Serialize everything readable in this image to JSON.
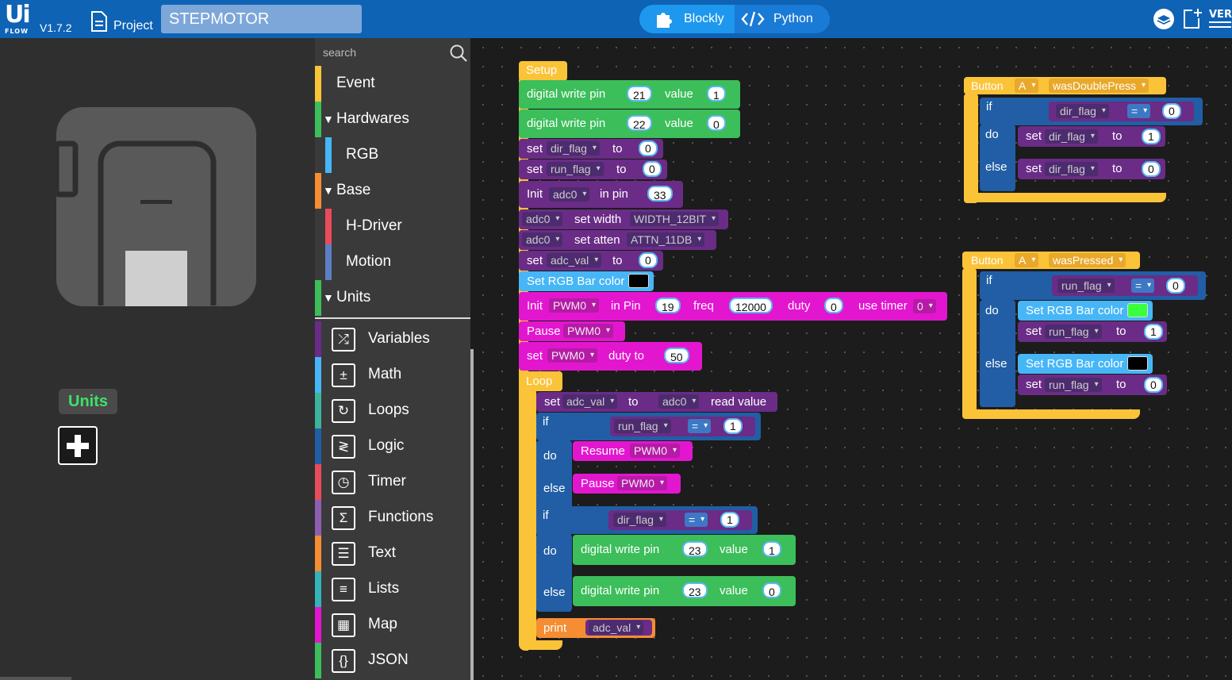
{
  "app": {
    "logo": "Ui",
    "logo_sub": "FLOW",
    "version": "V1.7.2",
    "project_label": "Project",
    "project_name": "STEPMOTOR"
  },
  "modes": {
    "blockly": "Blockly",
    "python": "Python"
  },
  "left": {
    "units_label": "Units"
  },
  "toolbox": {
    "search_placeholder": "search",
    "categories": [
      {
        "label": "Event",
        "color": "#fbc338"
      },
      {
        "label": "Hardwares",
        "color": "#3cbe5a"
      },
      {
        "label": "RGB",
        "color": "#46b6f7"
      },
      {
        "label": "Base",
        "color": "#f58d33"
      },
      {
        "label": "H-Driver",
        "color": "#e84b5a"
      },
      {
        "label": "Motion",
        "color": "#5c7fc4"
      },
      {
        "label": "Units",
        "color": "#3cbe5a"
      },
      {
        "label": "Variables",
        "color": "#6a2c86"
      },
      {
        "label": "Math",
        "color": "#46b6f7"
      },
      {
        "label": "Loops",
        "color": "#3cb39a"
      },
      {
        "label": "Logic",
        "color": "#215ea5"
      },
      {
        "label": "Timer",
        "color": "#e84b5a"
      },
      {
        "label": "Functions",
        "color": "#8e5fb0"
      },
      {
        "label": "Text",
        "color": "#f58d33"
      },
      {
        "label": "Lists",
        "color": "#34b3b8"
      },
      {
        "label": "Map",
        "color": "#e316cf"
      },
      {
        "label": "JSON",
        "color": "#3cbe5a"
      }
    ]
  },
  "blocks": {
    "setup": "Setup",
    "loop": "Loop",
    "dwp": "digital write pin",
    "value": "value",
    "set": "set",
    "to": "to",
    "init": "Init",
    "in_pin": "in pin",
    "in_pin2": "in Pin",
    "set_width": "set width",
    "set_atten": "set atten",
    "set_rgb": "Set RGB Bar color",
    "freq": "freq",
    "duty": "duty",
    "use_timer": "use timer",
    "pause": "Pause",
    "resume": "Resume",
    "duty_to": "duty to",
    "read_value": "read value",
    "if": "if",
    "do": "do",
    "else": "else",
    "print": "print",
    "button": "Button",
    "btn_a": "A",
    "was_double": "wasDoublePress",
    "was_pressed": "wasPressed",
    "eq": "=",
    "var_dir": "dir_flag",
    "var_run": "run_flag",
    "var_adcval": "adc_val",
    "adc0": "adc0",
    "pwm0": "PWM0",
    "width": "WIDTH_12BIT",
    "atten": "ATTN_11DB",
    "n21": "21",
    "n22": "22",
    "n23": "23",
    "n1": "1",
    "n0": "0",
    "n33": "33",
    "n19": "19",
    "n12000": "12000",
    "n50": "50"
  },
  "colors": {
    "topbar": "#0e63b5",
    "units_green": "#3ce26a",
    "rgb_black": "#000000",
    "rgb_green": "#39ff3c"
  }
}
